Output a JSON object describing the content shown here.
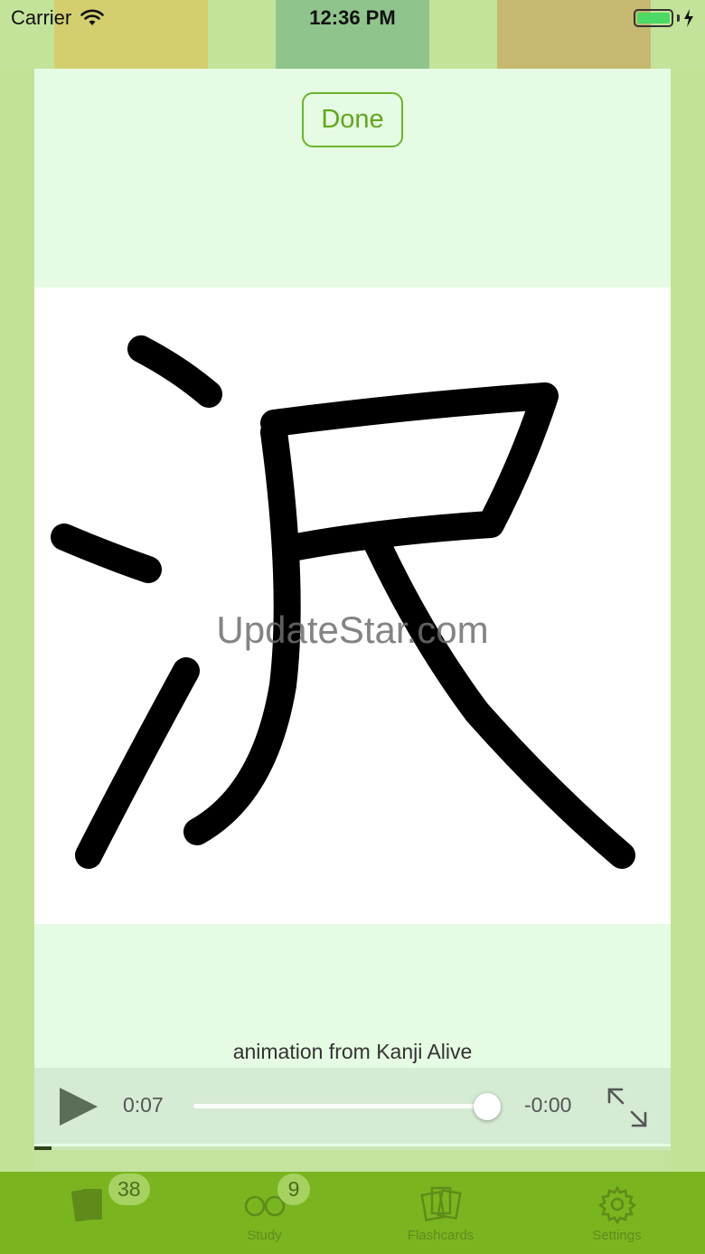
{
  "status_bar": {
    "carrier": "Carrier",
    "time": "12:36 PM",
    "wifi_icon": "wifi-icon",
    "battery_icon": "battery-icon",
    "charging_icon": "charging-bolt-icon"
  },
  "modal": {
    "done_label": "Done",
    "watermark": "UpdateStar.com",
    "credit": "animation from Kanji Alive",
    "kanji_icon": "kanji-stroke-drawing",
    "player": {
      "current_time": "0:07",
      "remaining_time": "-0:00",
      "scrubber_progress": 0.99,
      "playback_progress": 0.027,
      "play_icon": "play-icon",
      "fullscreen_icon": "fullscreen-expand-icon"
    }
  },
  "tab_bar": {
    "items": [
      {
        "label": "",
        "badge": "38",
        "icon": "cards-icon"
      },
      {
        "label": "Study",
        "badge": "9",
        "icon": "glasses-icon"
      },
      {
        "label": "Flashcards",
        "badge": "",
        "icon": "flashcards-icon"
      },
      {
        "label": "Settings",
        "badge": "",
        "icon": "gear-icon"
      }
    ]
  },
  "colors": {
    "accent": "#6db42a",
    "tab_bar": "#7ab51f",
    "modal_bg": "#e6fbe3"
  }
}
